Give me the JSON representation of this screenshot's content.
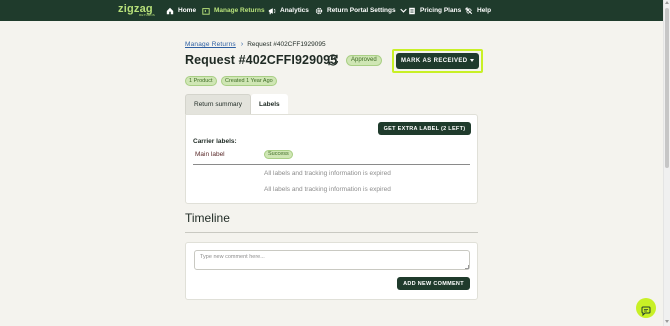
{
  "brand": {
    "logo_text": "zigzag",
    "logo_sub": "RETURNS"
  },
  "nav": {
    "items": [
      {
        "label": "Home",
        "icon": "home-icon"
      },
      {
        "label": "Manage Returns",
        "icon": "returns-box-icon",
        "active": true
      },
      {
        "label": "Analytics",
        "icon": "megaphone-icon"
      },
      {
        "label": "Return Portal Settings",
        "icon": "gear-icon",
        "has_dropdown": true
      },
      {
        "label": "Pricing Plans",
        "icon": "document-icon"
      },
      {
        "label": "Help",
        "icon": "help-tools-icon"
      }
    ]
  },
  "breadcrumb": {
    "parent": "Manage Returns",
    "separator": "›",
    "current": "Request #402CFF1929095"
  },
  "request": {
    "title": "Request #402CFFI929095",
    "status": "Approved",
    "chips": [
      "1 Product",
      "Created 1 Year Ago"
    ]
  },
  "actions": {
    "mark_received": "MARK AS RECEIVED"
  },
  "tabs": [
    {
      "label": "Return summary",
      "active": false
    },
    {
      "label": "Labels",
      "active": true
    }
  ],
  "labels_panel": {
    "extra_label_button": "GET EXTRA LABEL (2 LEFT)",
    "carrier_heading": "Carrier labels:",
    "rows": [
      {
        "name": "Main label",
        "status": "Success"
      }
    ],
    "expired_messages": [
      "All labels and tracking information is expired",
      "All labels and tracking information is expired"
    ]
  },
  "timeline": {
    "heading": "Timeline",
    "comment_placeholder": "Type new comment here...",
    "add_comment_button": "ADD NEW COMMENT"
  },
  "colors": {
    "topbar": "#1f3b2c",
    "accent": "#b7e07a",
    "highlight": "#c8f026",
    "button": "#1f3b2c",
    "pill_bg": "#cfe6b4"
  }
}
